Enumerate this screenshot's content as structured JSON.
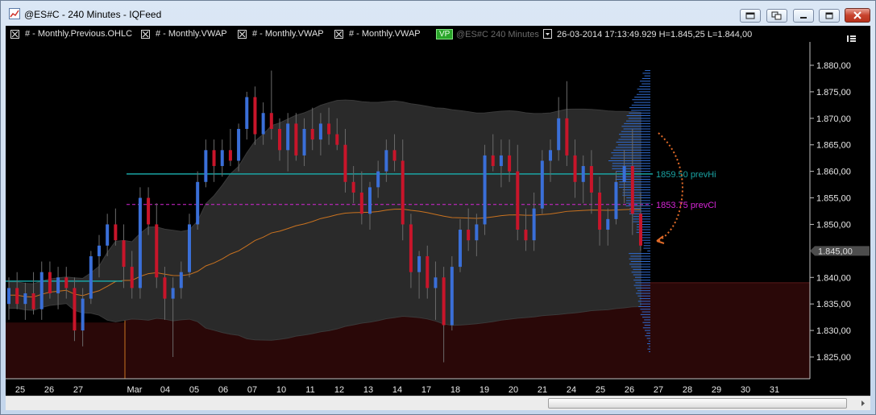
{
  "window": {
    "title": "@ES#C - 240 Minutes - IQFeed",
    "buttons": [
      "restore-dock",
      "link",
      "minimize",
      "maximize",
      "close"
    ]
  },
  "legend": {
    "items": [
      {
        "label": "# - Monthly.Previous.OHLC"
      },
      {
        "label": "# - Monthly.VWAP"
      },
      {
        "label": "# - Monthly.VWAP"
      },
      {
        "label": "# - Monthly.VWAP"
      }
    ],
    "vp_badge": "VP",
    "symbol_dim": "@ES#C  240 Minutes",
    "ohlc_readout": "26-03-2014  17:13:49.929  H=1.845,25  L=1.844,00"
  },
  "price_axis": {
    "ticks": [
      "1.880,00",
      "1.875,00",
      "1.870,00",
      "1.865,00",
      "1.860,00",
      "1.855,00",
      "1.850,00",
      "1.845,00",
      "1.840,00",
      "1.835,00",
      "1.830,00",
      "1.825,00"
    ],
    "current_price_label": "1.845,00"
  },
  "levels": {
    "prev_high": "1859.50 prevHi",
    "prev_close": "1853.75 prevCl"
  },
  "time_axis": {
    "ticks": [
      "25",
      "26",
      "27",
      "Mar",
      "04",
      "05",
      "06",
      "07",
      "10",
      "11",
      "12",
      "13",
      "14",
      "17",
      "18",
      "19",
      "20",
      "21",
      "24",
      "25",
      "26",
      "27",
      "28",
      "29",
      "30",
      "31"
    ]
  },
  "colors": {
    "background": "#000000",
    "bull": "#3a6fd8",
    "bear": "#c8152a",
    "band": "#2a2a2a",
    "vwap": "#c9721f",
    "prev_high_line": "#1aa3a3",
    "prev_close_line": "#d626d6",
    "prior_month_fill": "#2a0808",
    "volume_profile": "#2f6bd0"
  },
  "chart_data": {
    "type": "candlestick",
    "symbol": "@ES#C",
    "interval": "240 Minutes",
    "ylim": [
      1822,
      1882
    ],
    "bars": [
      {
        "o": 1835,
        "h": 1840,
        "l": 1832,
        "c": 1838
      },
      {
        "o": 1838,
        "h": 1841,
        "l": 1834,
        "c": 1835
      },
      {
        "o": 1835,
        "h": 1839,
        "l": 1832,
        "c": 1837
      },
      {
        "o": 1837,
        "h": 1841,
        "l": 1833,
        "c": 1834
      },
      {
        "o": 1834,
        "h": 1843,
        "l": 1832,
        "c": 1841
      },
      {
        "o": 1841,
        "h": 1843,
        "l": 1836,
        "c": 1837
      },
      {
        "o": 1837,
        "h": 1842,
        "l": 1834,
        "c": 1840
      },
      {
        "o": 1840,
        "h": 1842,
        "l": 1836,
        "c": 1838
      },
      {
        "o": 1838,
        "h": 1840,
        "l": 1828,
        "c": 1830
      },
      {
        "o": 1830,
        "h": 1838,
        "l": 1827,
        "c": 1836
      },
      {
        "o": 1836,
        "h": 1845,
        "l": 1835,
        "c": 1844
      },
      {
        "o": 1844,
        "h": 1848,
        "l": 1840,
        "c": 1846
      },
      {
        "o": 1846,
        "h": 1852,
        "l": 1844,
        "c": 1850
      },
      {
        "o": 1850,
        "h": 1853,
        "l": 1846,
        "c": 1847
      },
      {
        "o": 1847,
        "h": 1850,
        "l": 1838,
        "c": 1842
      },
      {
        "o": 1842,
        "h": 1845,
        "l": 1836,
        "c": 1838
      },
      {
        "o": 1838,
        "h": 1857,
        "l": 1836,
        "c": 1855
      },
      {
        "o": 1855,
        "h": 1857,
        "l": 1848,
        "c": 1850
      },
      {
        "o": 1850,
        "h": 1854,
        "l": 1838,
        "c": 1840
      },
      {
        "o": 1840,
        "h": 1842,
        "l": 1832,
        "c": 1836
      },
      {
        "o": 1836,
        "h": 1840,
        "l": 1825,
        "c": 1838
      },
      {
        "o": 1838,
        "h": 1843,
        "l": 1836,
        "c": 1841
      },
      {
        "o": 1841,
        "h": 1852,
        "l": 1840,
        "c": 1850
      },
      {
        "o": 1850,
        "h": 1860,
        "l": 1849,
        "c": 1858
      },
      {
        "o": 1858,
        "h": 1866,
        "l": 1857,
        "c": 1864
      },
      {
        "o": 1864,
        "h": 1866,
        "l": 1858,
        "c": 1861
      },
      {
        "o": 1861,
        "h": 1866,
        "l": 1859,
        "c": 1864
      },
      {
        "o": 1864,
        "h": 1868,
        "l": 1861,
        "c": 1862
      },
      {
        "o": 1862,
        "h": 1869,
        "l": 1860,
        "c": 1868
      },
      {
        "o": 1868,
        "h": 1875,
        "l": 1866,
        "c": 1874
      },
      {
        "o": 1874,
        "h": 1876,
        "l": 1865,
        "c": 1867
      },
      {
        "o": 1867,
        "h": 1873,
        "l": 1865,
        "c": 1871
      },
      {
        "o": 1871,
        "h": 1879,
        "l": 1866,
        "c": 1868
      },
      {
        "o": 1868,
        "h": 1870,
        "l": 1862,
        "c": 1864
      },
      {
        "o": 1864,
        "h": 1871,
        "l": 1860,
        "c": 1869
      },
      {
        "o": 1869,
        "h": 1871,
        "l": 1862,
        "c": 1863
      },
      {
        "o": 1863,
        "h": 1870,
        "l": 1861,
        "c": 1868
      },
      {
        "o": 1868,
        "h": 1872,
        "l": 1864,
        "c": 1866
      },
      {
        "o": 1866,
        "h": 1871,
        "l": 1863,
        "c": 1869
      },
      {
        "o": 1869,
        "h": 1872,
        "l": 1865,
        "c": 1867
      },
      {
        "o": 1867,
        "h": 1870,
        "l": 1864,
        "c": 1865
      },
      {
        "o": 1865,
        "h": 1868,
        "l": 1856,
        "c": 1858
      },
      {
        "o": 1858,
        "h": 1861,
        "l": 1854,
        "c": 1856
      },
      {
        "o": 1856,
        "h": 1860,
        "l": 1850,
        "c": 1852
      },
      {
        "o": 1852,
        "h": 1858,
        "l": 1849,
        "c": 1857
      },
      {
        "o": 1857,
        "h": 1862,
        "l": 1855,
        "c": 1860
      },
      {
        "o": 1860,
        "h": 1866,
        "l": 1858,
        "c": 1864
      },
      {
        "o": 1864,
        "h": 1867,
        "l": 1860,
        "c": 1862
      },
      {
        "o": 1862,
        "h": 1866,
        "l": 1847,
        "c": 1850
      },
      {
        "o": 1850,
        "h": 1852,
        "l": 1838,
        "c": 1841
      },
      {
        "o": 1841,
        "h": 1845,
        "l": 1836,
        "c": 1844
      },
      {
        "o": 1844,
        "h": 1846,
        "l": 1836,
        "c": 1838
      },
      {
        "o": 1838,
        "h": 1843,
        "l": 1832,
        "c": 1840
      },
      {
        "o": 1840,
        "h": 1842,
        "l": 1824,
        "c": 1831
      },
      {
        "o": 1831,
        "h": 1844,
        "l": 1830,
        "c": 1842
      },
      {
        "o": 1842,
        "h": 1851,
        "l": 1841,
        "c": 1849
      },
      {
        "o": 1849,
        "h": 1853,
        "l": 1845,
        "c": 1847
      },
      {
        "o": 1847,
        "h": 1852,
        "l": 1844,
        "c": 1850
      },
      {
        "o": 1850,
        "h": 1865,
        "l": 1848,
        "c": 1863
      },
      {
        "o": 1863,
        "h": 1867,
        "l": 1860,
        "c": 1861
      },
      {
        "o": 1861,
        "h": 1866,
        "l": 1857,
        "c": 1863
      },
      {
        "o": 1863,
        "h": 1866,
        "l": 1858,
        "c": 1860
      },
      {
        "o": 1860,
        "h": 1865,
        "l": 1847,
        "c": 1849
      },
      {
        "o": 1849,
        "h": 1853,
        "l": 1845,
        "c": 1847
      },
      {
        "o": 1847,
        "h": 1856,
        "l": 1845,
        "c": 1853
      },
      {
        "o": 1853,
        "h": 1864,
        "l": 1852,
        "c": 1862
      },
      {
        "o": 1862,
        "h": 1866,
        "l": 1858,
        "c": 1864
      },
      {
        "o": 1864,
        "h": 1874,
        "l": 1862,
        "c": 1870
      },
      {
        "o": 1870,
        "h": 1877,
        "l": 1861,
        "c": 1863
      },
      {
        "o": 1863,
        "h": 1866,
        "l": 1855,
        "c": 1858
      },
      {
        "o": 1858,
        "h": 1863,
        "l": 1854,
        "c": 1861
      },
      {
        "o": 1861,
        "h": 1864,
        "l": 1852,
        "c": 1856
      },
      {
        "o": 1856,
        "h": 1859,
        "l": 1846,
        "c": 1849
      },
      {
        "o": 1849,
        "h": 1853,
        "l": 1846,
        "c": 1851
      },
      {
        "o": 1851,
        "h": 1860,
        "l": 1850,
        "c": 1858
      },
      {
        "o": 1858,
        "h": 1864,
        "l": 1854,
        "c": 1861
      },
      {
        "o": 1861,
        "h": 1868,
        "l": 1848,
        "c": 1852
      },
      {
        "o": 1852,
        "h": 1856,
        "l": 1845,
        "c": 1846
      }
    ]
  }
}
